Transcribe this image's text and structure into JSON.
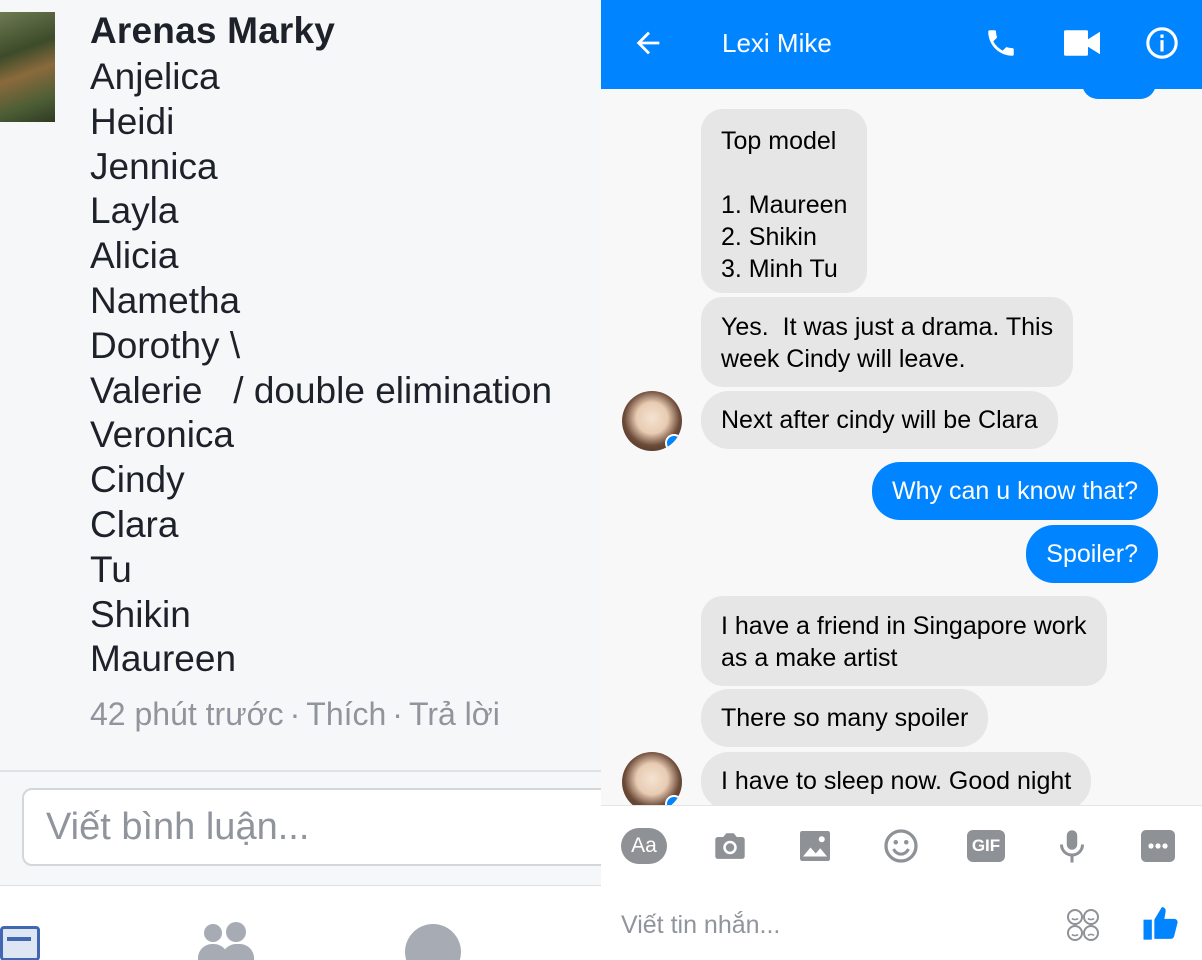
{
  "comment": {
    "author": "Arenas Marky",
    "contestants": [
      "Anjelica",
      "Heidi",
      "Jennica",
      "Layla",
      "Alicia",
      "Nametha",
      "Dorothy \\",
      "Valerie   / double elimination",
      "Veronica",
      "Cindy",
      "Clara",
      "Tu",
      "Shikin",
      "Maureen"
    ],
    "time": "42 phút trước",
    "like": "Thích",
    "reply": "Trả lời",
    "separator": "·"
  },
  "comment_input": {
    "placeholder": "Viết bình luận..."
  },
  "bottom_nav": {
    "icons": [
      "news-feed-icon",
      "friends-icon",
      "messenger-icon"
    ]
  },
  "messenger": {
    "contact_name": "Lexi Mike",
    "accent_color": "#0084ff",
    "header_icons": [
      "back-arrow-icon",
      "phone-icon",
      "video-icon",
      "info-icon"
    ],
    "messages": [
      {
        "from": "them",
        "text": "Top model\n\n1. Maureen\n2. Shikin\n3. Minh Tu"
      },
      {
        "from": "them",
        "text": "Yes.  It was just a drama. This\nweek Cindy will leave."
      },
      {
        "from": "them",
        "text": "Next after cindy will be Clara"
      },
      {
        "from": "me",
        "text": "Why can u know that?"
      },
      {
        "from": "me",
        "text": "Spoiler?"
      },
      {
        "from": "them",
        "text": "I have a friend in Singapore work\nas a make artist"
      },
      {
        "from": "them",
        "text": "There so many spoiler"
      },
      {
        "from": "them",
        "text": "I have to sleep now. Good night"
      }
    ],
    "toolbar": {
      "text_label": "Aa",
      "gif_label": "GIF",
      "icons": [
        "text-style-icon",
        "camera-icon",
        "gallery-icon",
        "emoji-icon",
        "gif-icon",
        "microphone-icon",
        "more-icon"
      ]
    },
    "composer_placeholder": "Viết tin nhắn...",
    "composer_icons": [
      "sticker-icon",
      "like-thumb-icon"
    ]
  }
}
